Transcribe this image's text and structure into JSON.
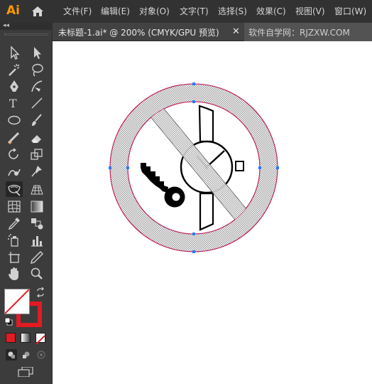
{
  "app": {
    "logo": "Ai"
  },
  "menubar": {
    "items": [
      "文件(F)",
      "编辑(E)",
      "对象(O)",
      "文字(T)",
      "选择(S)",
      "效果(C)",
      "视图(V)",
      "窗口(W)"
    ]
  },
  "toolbar": {
    "collapse": "◂◂"
  },
  "tabs": {
    "document_title": "未标题-1.ai* @ 200% (CMYK/GPU 预览)",
    "close": "✕",
    "watermark": "软件自学网：RJZXW.COM"
  },
  "colors": {
    "stroke": "#e21b23",
    "ring_outline": "#c2185b",
    "anchor": "#2979ff",
    "ui_dark": "#323232",
    "ui_panel": "#3c3c3c",
    "canvas": "#ffffff"
  }
}
